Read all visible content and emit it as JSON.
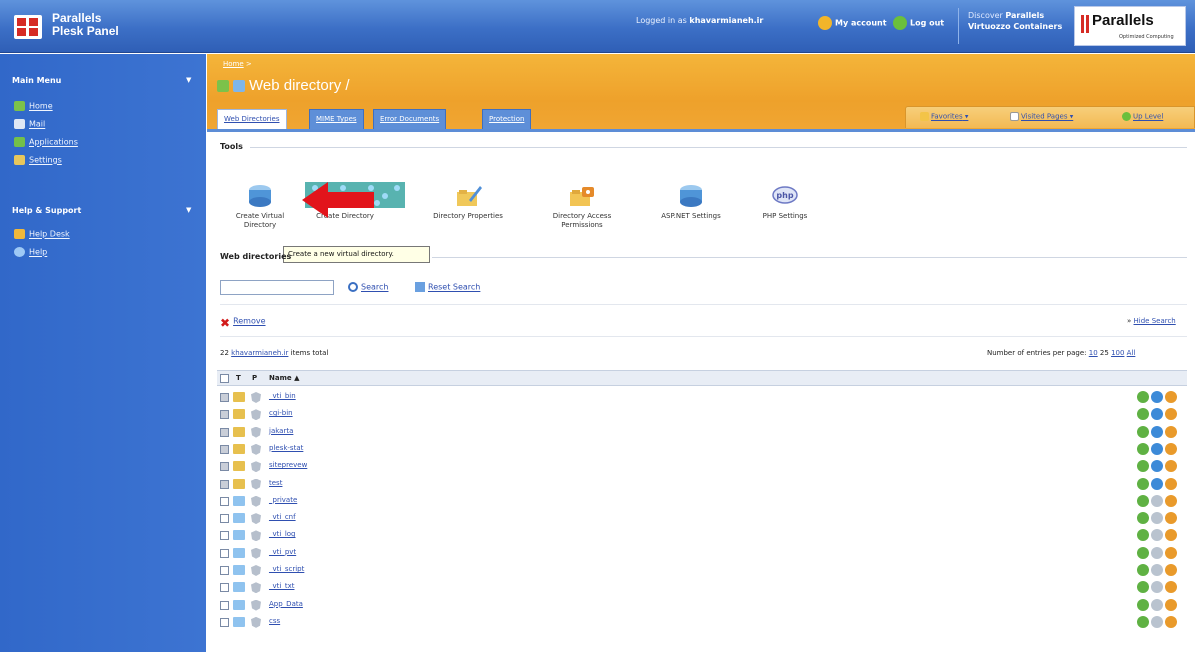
{
  "topbar": {
    "product_line1": "Parallels",
    "product_line2": "Plesk Panel",
    "logged_in_prefix": "Logged in as",
    "username": "khavarmianeh.ir",
    "my_account": "My account",
    "log_out": "Log out",
    "discover_line1_prefix": "Discover",
    "discover_line1_bold": "Parallels",
    "discover_line2": "Virtuozzo Containers",
    "brand_word": "Parallels",
    "brand_tagline": "Optimized Computing"
  },
  "sidebar": {
    "main_menu": "Main Menu",
    "main_items": [
      {
        "label": "Home",
        "icon": "home-icon"
      },
      {
        "label": "Mail",
        "icon": "mail-icon"
      },
      {
        "label": "Applications",
        "icon": "applications-icon"
      },
      {
        "label": "Settings",
        "icon": "settings-icon"
      }
    ],
    "help_support": "Help & Support",
    "help_items": [
      {
        "label": "Help Desk",
        "icon": "help-desk-icon"
      },
      {
        "label": "Help",
        "icon": "help-icon"
      }
    ]
  },
  "header": {
    "breadcrumb": "Home",
    "breadcrumb_sep": ">",
    "title": "Web directory /",
    "tabs": [
      "Web Directories",
      "MIME Types",
      "Error Documents",
      "Protection"
    ],
    "favorites": "Favorites",
    "visited_pages": "Visited Pages",
    "up_level": "Up Level"
  },
  "tools": {
    "label": "Tools",
    "items": [
      {
        "label": "Create Virtual Directory",
        "icon": "create-virtual-directory-icon"
      },
      {
        "label": "Create Directory",
        "icon": "create-directory-icon"
      },
      {
        "label": "Directory Properties",
        "icon": "directory-properties-icon"
      },
      {
        "label": "Directory Access Permissions",
        "icon": "access-permissions-icon"
      },
      {
        "label": "ASP.NET Settings",
        "icon": "aspnet-settings-icon"
      },
      {
        "label": "PHP Settings",
        "icon": "php-settings-icon"
      }
    ],
    "tooltip": "Create a new virtual directory."
  },
  "list": {
    "section_label": "Web directories",
    "search_value": "",
    "search": "Search",
    "reset_search": "Reset Search",
    "remove": "Remove",
    "hide_search": "Hide Search",
    "items_total_count": "22",
    "items_total_domain": "khavarmianeh.ir",
    "items_total_suffix": "items total",
    "per_page_label": "Number of entries per page:",
    "per_page_options": [
      "10",
      "25",
      "100",
      "All"
    ],
    "columns": {
      "t": "T",
      "p": "P",
      "name": "Name"
    },
    "rows": [
      {
        "name": "_vti_bin",
        "type": "virtual"
      },
      {
        "name": "cgi-bin",
        "type": "virtual"
      },
      {
        "name": "jakarta",
        "type": "virtual"
      },
      {
        "name": "plesk-stat",
        "type": "virtual"
      },
      {
        "name": "siteprevew",
        "type": "virtual"
      },
      {
        "name": "test",
        "type": "virtual"
      },
      {
        "name": "_private",
        "type": "physical"
      },
      {
        "name": "_vti_cnf",
        "type": "physical"
      },
      {
        "name": "_vti_log",
        "type": "physical"
      },
      {
        "name": "_vti_pvt",
        "type": "physical"
      },
      {
        "name": "_vti_script",
        "type": "physical"
      },
      {
        "name": "_vti_txt",
        "type": "physical"
      },
      {
        "name": "App_Data",
        "type": "physical"
      },
      {
        "name": "css",
        "type": "physical"
      }
    ]
  }
}
